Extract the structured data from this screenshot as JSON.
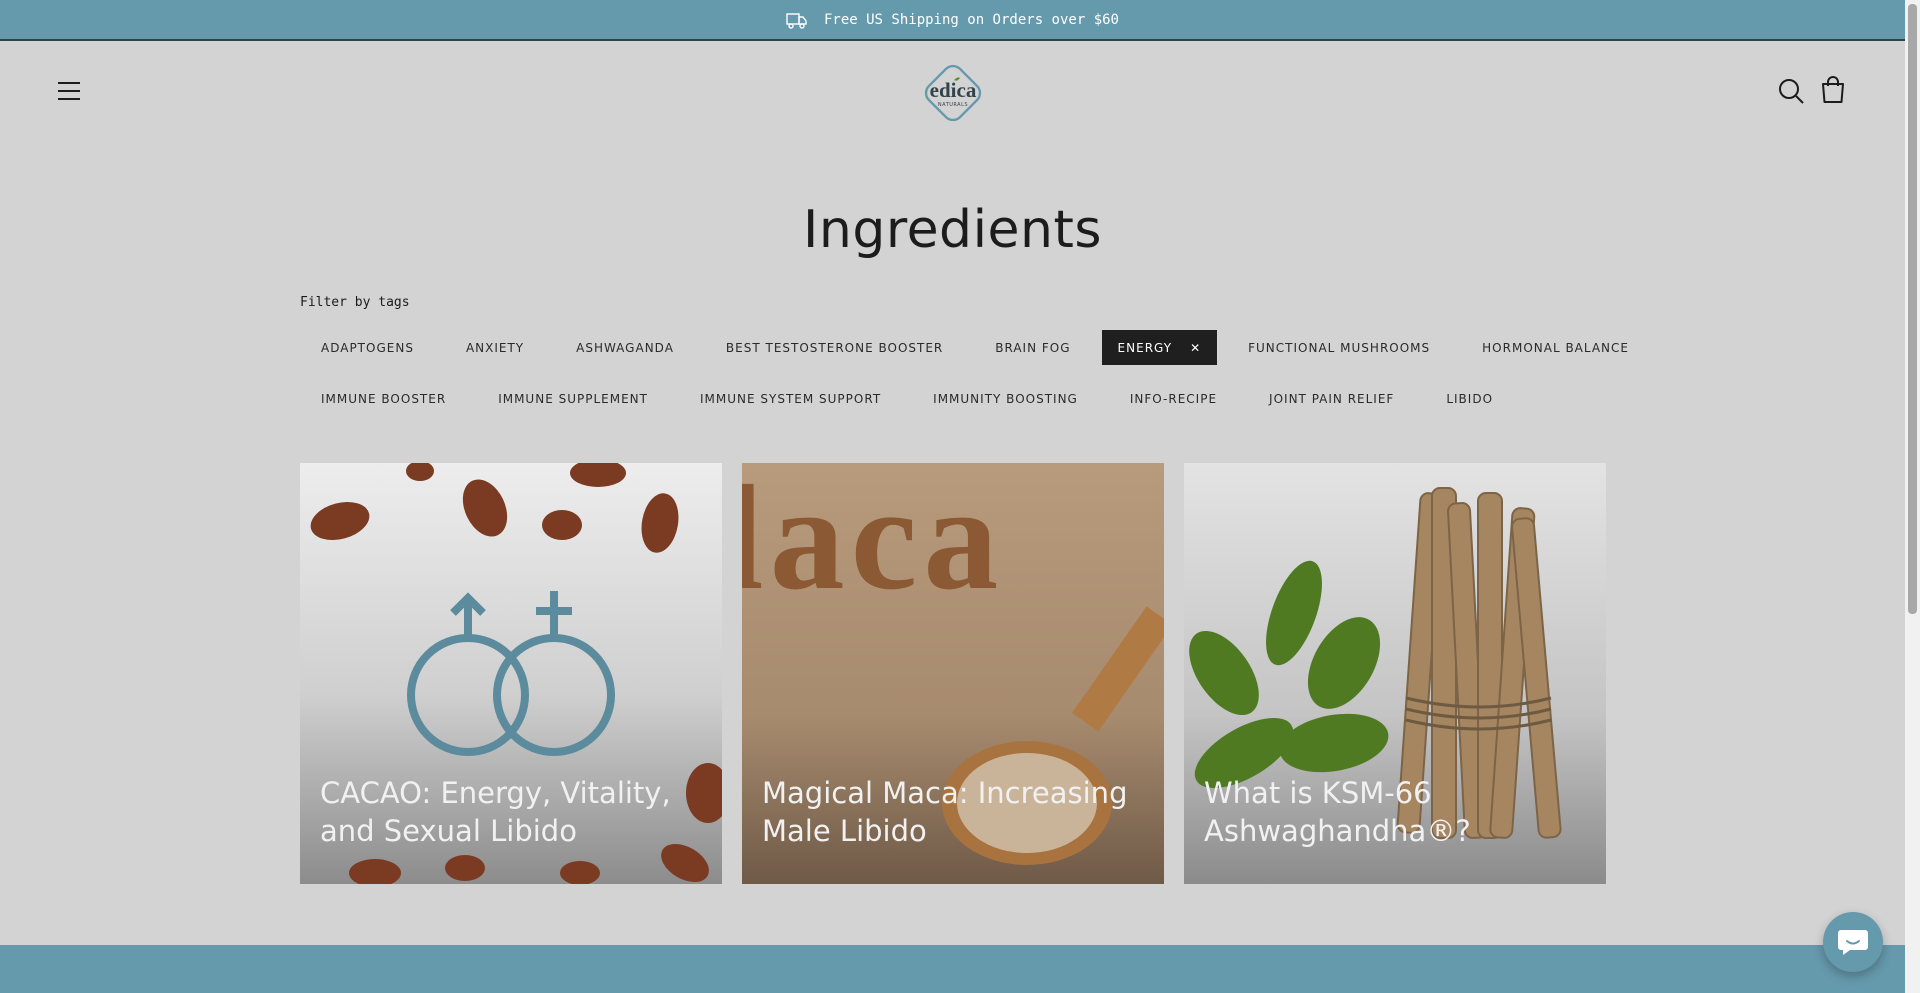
{
  "announcement": {
    "text": "Free US Shipping on Orders over $60",
    "icon": "truck-icon"
  },
  "header": {
    "menu_icon": "hamburger-menu-icon",
    "logo_text": "edica",
    "logo_sub": "NATURALS",
    "search_icon": "search-icon",
    "cart_icon": "shopping-bag-icon"
  },
  "page": {
    "title": "Ingredients",
    "filter_label": "Filter by tags"
  },
  "tags_row1": [
    {
      "label": "ADAPTOGENS"
    },
    {
      "label": "ANXIETY"
    },
    {
      "label": "ASHWAGANDA"
    },
    {
      "label": "BEST TESTOSTERONE BOOSTER"
    },
    {
      "label": "BRAIN FOG"
    },
    {
      "label": "ENERGY",
      "active": true
    },
    {
      "label": "FUNCTIONAL MUSHROOMS"
    },
    {
      "label": "HORMONAL BALANCE"
    }
  ],
  "tags_row2": [
    {
      "label": "IMMUNE BOOSTER"
    },
    {
      "label": "IMMUNE SUPPLEMENT"
    },
    {
      "label": "IMMUNE SYSTEM SUPPORT"
    },
    {
      "label": "IMMUNITY BOOSTING"
    },
    {
      "label": "INFO-RECIPE"
    },
    {
      "label": "JOINT PAIN RELIEF"
    },
    {
      "label": "LIBIDO"
    }
  ],
  "active_tag_remove": "✕",
  "articles": [
    {
      "title": "CACAO: Energy, Vitality, and Sexual Libido"
    },
    {
      "title": "Magical Maca: Increasing Male Libido",
      "image_text": "laca"
    },
    {
      "title": "What is KSM-66 Ashwaghandha®?"
    }
  ],
  "colors": {
    "brand_teal": "#6599ac",
    "background": "#d3d3d3",
    "active_tag": "#1f1f1f"
  },
  "chat": {
    "icon": "chat-bubble-icon"
  }
}
